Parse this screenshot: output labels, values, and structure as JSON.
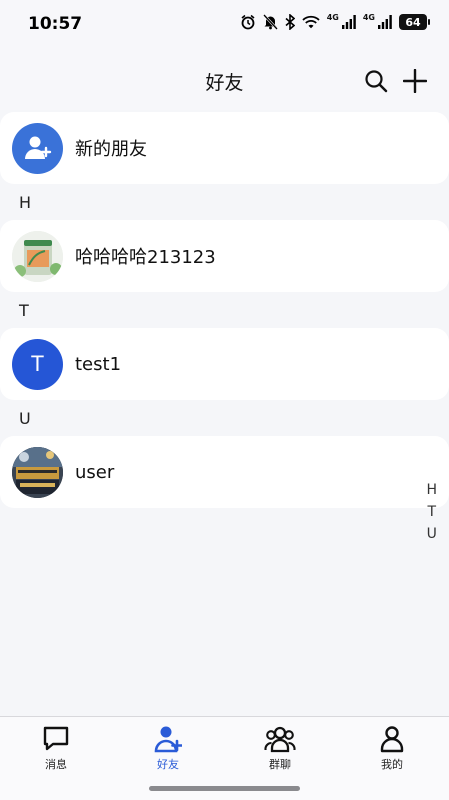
{
  "status_bar": {
    "time": "10:57",
    "network_1": "4G",
    "network_2": "4G",
    "battery": "64"
  },
  "header": {
    "title": "好友",
    "search_icon": "search-icon",
    "add_icon": "plus-icon"
  },
  "new_friends": {
    "label": "新的朋友",
    "icon": "add-user-icon",
    "color": "#3a72d8"
  },
  "sections": [
    {
      "letter": "H",
      "contact": {
        "name": "哈哈哈哈213123",
        "avatar": "product-photo"
      }
    },
    {
      "letter": "T",
      "contact": {
        "name": "test1",
        "avatar_letter": "T",
        "avatar_color": "#2556d6"
      }
    },
    {
      "letter": "U",
      "contact": {
        "name": "user",
        "avatar": "photo"
      }
    }
  ],
  "index_letters": [
    "H",
    "T",
    "U"
  ],
  "tabs": [
    {
      "label": "消息",
      "icon": "message-icon"
    },
    {
      "label": "好友",
      "icon": "friends-icon",
      "active": true
    },
    {
      "label": "群聊",
      "icon": "group-icon"
    },
    {
      "label": "我的",
      "icon": "profile-icon"
    }
  ],
  "colors": {
    "accent": "#2a5bd7",
    "background": "#f5f6f9"
  }
}
